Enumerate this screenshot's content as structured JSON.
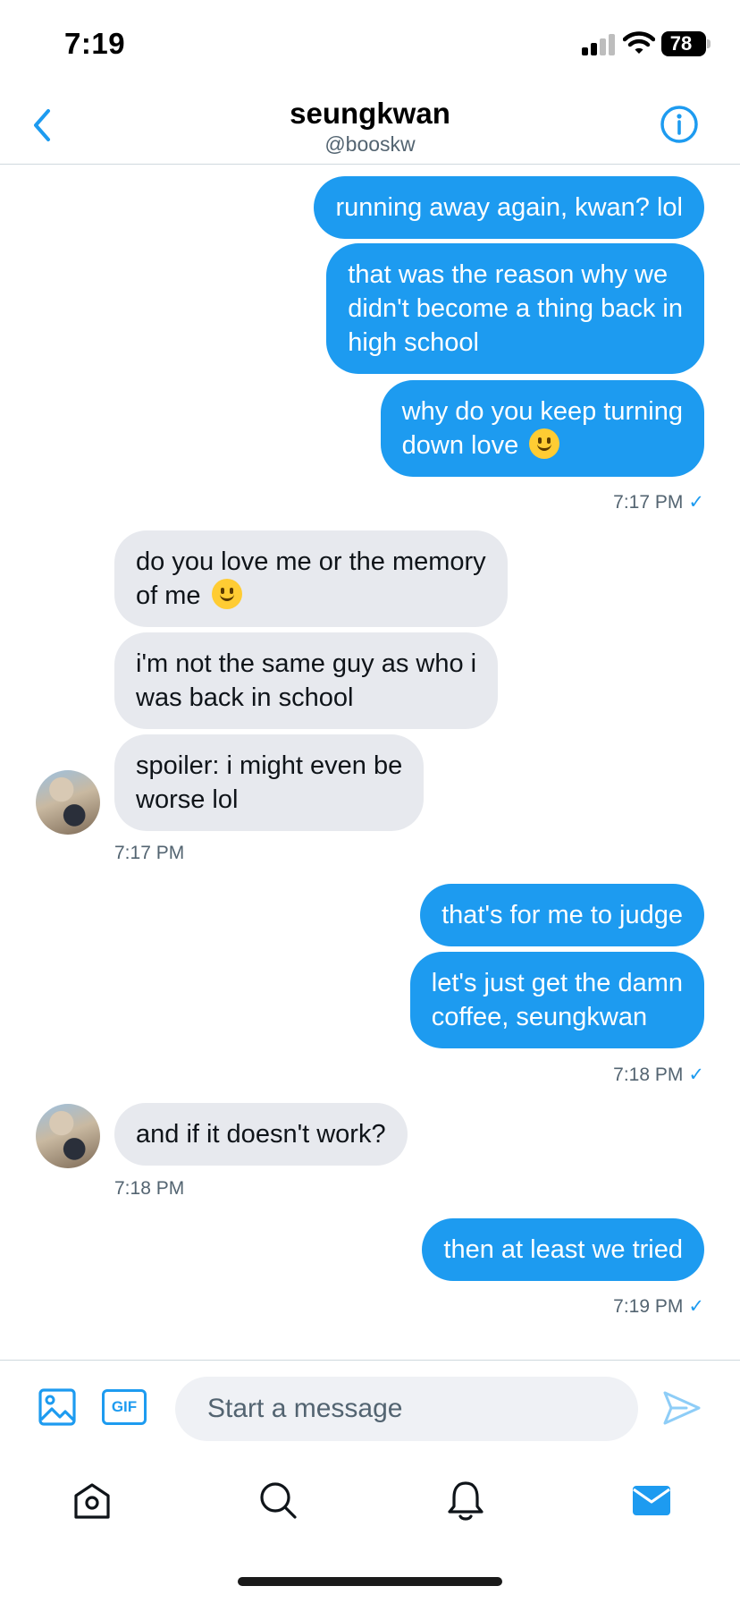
{
  "status_bar": {
    "time": "7:19",
    "battery": "78"
  },
  "header": {
    "name": "seungkwan",
    "handle": "@booskw"
  },
  "messages": [
    {
      "text": "running away again, kwan? lol"
    },
    {
      "line1": "that was the reason why we",
      "line2": "didn't become a thing back in",
      "line3": "high school"
    },
    {
      "line1": "why do you keep turning",
      "line2": "down love"
    },
    {
      "line1": "do you love me or the memory",
      "line2": "of me"
    },
    {
      "line1": "i'm not the same guy as who i",
      "line2": "was back in school"
    },
    {
      "line1": "spoiler: i might even be",
      "line2": "worse lol"
    },
    {
      "text": "that's for me to judge"
    },
    {
      "line1": "let's just get the damn",
      "line2": "coffee, seungkwan"
    },
    {
      "text": "and if it doesn't work?"
    },
    {
      "text": "then at least we tried"
    }
  ],
  "timestamps": [
    "7:17 PM",
    "7:17 PM",
    "7:18 PM",
    "7:18 PM",
    "7:19 PM"
  ],
  "composer": {
    "placeholder": "Start a message",
    "gif_label": "GIF"
  },
  "colors": {
    "accent": "#1d9bf0",
    "received_bubble": "#e7e9ee",
    "secondary_text": "#536471"
  },
  "icons": [
    "back-icon",
    "info-icon",
    "image-icon",
    "gif-icon",
    "send-icon",
    "home-icon",
    "search-icon",
    "bell-icon",
    "mail-icon"
  ]
}
